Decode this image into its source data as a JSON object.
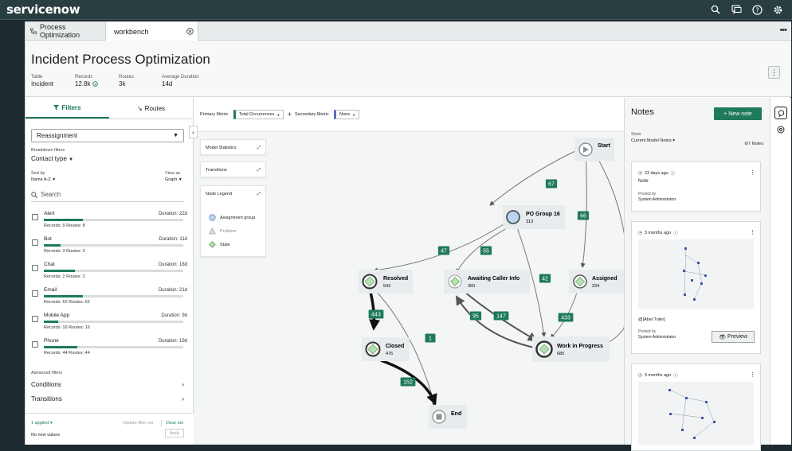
{
  "brand": {
    "logo": "servicenow",
    "accent": "#1f7a59",
    "topbar": "#293e40"
  },
  "topbar_icons": [
    "search-icon",
    "chat-icon",
    "help-icon",
    "gear-icon"
  ],
  "tabs": [
    {
      "label": "Process Optimization",
      "icon": "tree-icon"
    },
    {
      "label": "workbench",
      "icon": "close-icon"
    }
  ],
  "header": {
    "title": "Incident Process Optimization",
    "stats": [
      {
        "label": "Table",
        "value": "Incident"
      },
      {
        "label": "Records",
        "value": "12.8k"
      },
      {
        "label": "Routes",
        "value": "3k"
      },
      {
        "label": "Average Duration",
        "value": "14d"
      }
    ]
  },
  "left": {
    "tab_filters": "Filters",
    "tab_routes": "Routes",
    "select_value": "Reassignment",
    "breakdown_label": "Breakdown filters",
    "breakdown_value": "Contact type",
    "sort_label": "Sort by",
    "sort_value": "Name A-Z",
    "view_label": "View as",
    "view_value": "Graph",
    "search_placeholder": "Search",
    "sources": [
      {
        "name": "Alert",
        "duration": "Duration: 22d",
        "records": "Records: 9  Routes: 8",
        "fill": 0.28
      },
      {
        "name": "Bot",
        "duration": "Duration: 11d",
        "records": "Records: 3  Routes: 3",
        "fill": 0.12
      },
      {
        "name": "Chat",
        "duration": "Duration: 18d",
        "records": "Records: 2  Routes: 2",
        "fill": 0.22
      },
      {
        "name": "Email",
        "duration": "Duration: 21d",
        "records": "Records: 62  Routes: 62",
        "fill": 0.28
      },
      {
        "name": "Mobile App",
        "duration": "Duration: 9d",
        "records": "Records: 16  Routes: 16",
        "fill": 0.1
      },
      {
        "name": "Phone",
        "duration": "Duration: 19d",
        "records": "Records: 44  Routes: 44",
        "fill": 0.24
      }
    ],
    "advanced_label": "Advanced filters",
    "conditions": "Conditions",
    "transitions": "Transitions",
    "applied": "1 applied",
    "update_filter": "Update filter set",
    "clear_set": "Clear set",
    "no_new_values": "No new values",
    "apply": "Apply"
  },
  "canvas": {
    "primary_metric_label": "Primary Metric",
    "primary_metric_value": "Total Occurrences",
    "secondary_metric_label": "Secondary Metric",
    "secondary_metric_value": "None",
    "panel_stats": "Model Statistics",
    "panel_transitions": "Transitions",
    "panel_legend": "Node Legend",
    "legend": [
      "Assignment group",
      "Problem",
      "State"
    ],
    "nodes": [
      {
        "id": "start",
        "label": "Start",
        "count": ""
      },
      {
        "id": "po",
        "label": "PO Group 16",
        "count": "313"
      },
      {
        "id": "resolved",
        "label": "Resolved",
        "count": "543"
      },
      {
        "id": "awaiting",
        "label": "Awaiting Caller Info",
        "count": "360"
      },
      {
        "id": "assigned",
        "label": "Assigned",
        "count": "234"
      },
      {
        "id": "closed",
        "label": "Closed",
        "count": "476"
      },
      {
        "id": "wip",
        "label": "Work in Progress",
        "count": "680"
      },
      {
        "id": "end",
        "label": "End",
        "count": ""
      }
    ],
    "edges": [
      "67",
      "66",
      "47",
      "55",
      "42",
      "83",
      "443",
      "1",
      "147",
      "95",
      "433",
      "152"
    ]
  },
  "notes": {
    "title": "Notes",
    "new_note": "New note",
    "show_label": "Show",
    "show_value": "Current Model Notes",
    "count": "6/7 Notes",
    "cards": [
      {
        "time": "23 days ago",
        "body": "Note",
        "posted_label": "Posted by",
        "posted_by": "System Administrator"
      },
      {
        "time": "3 months ago",
        "body": "@[Abel Tuter]",
        "posted_label": "Posted by",
        "posted_by": "System Administrator",
        "preview": "Preview"
      },
      {
        "time": "3 months ago"
      }
    ]
  }
}
